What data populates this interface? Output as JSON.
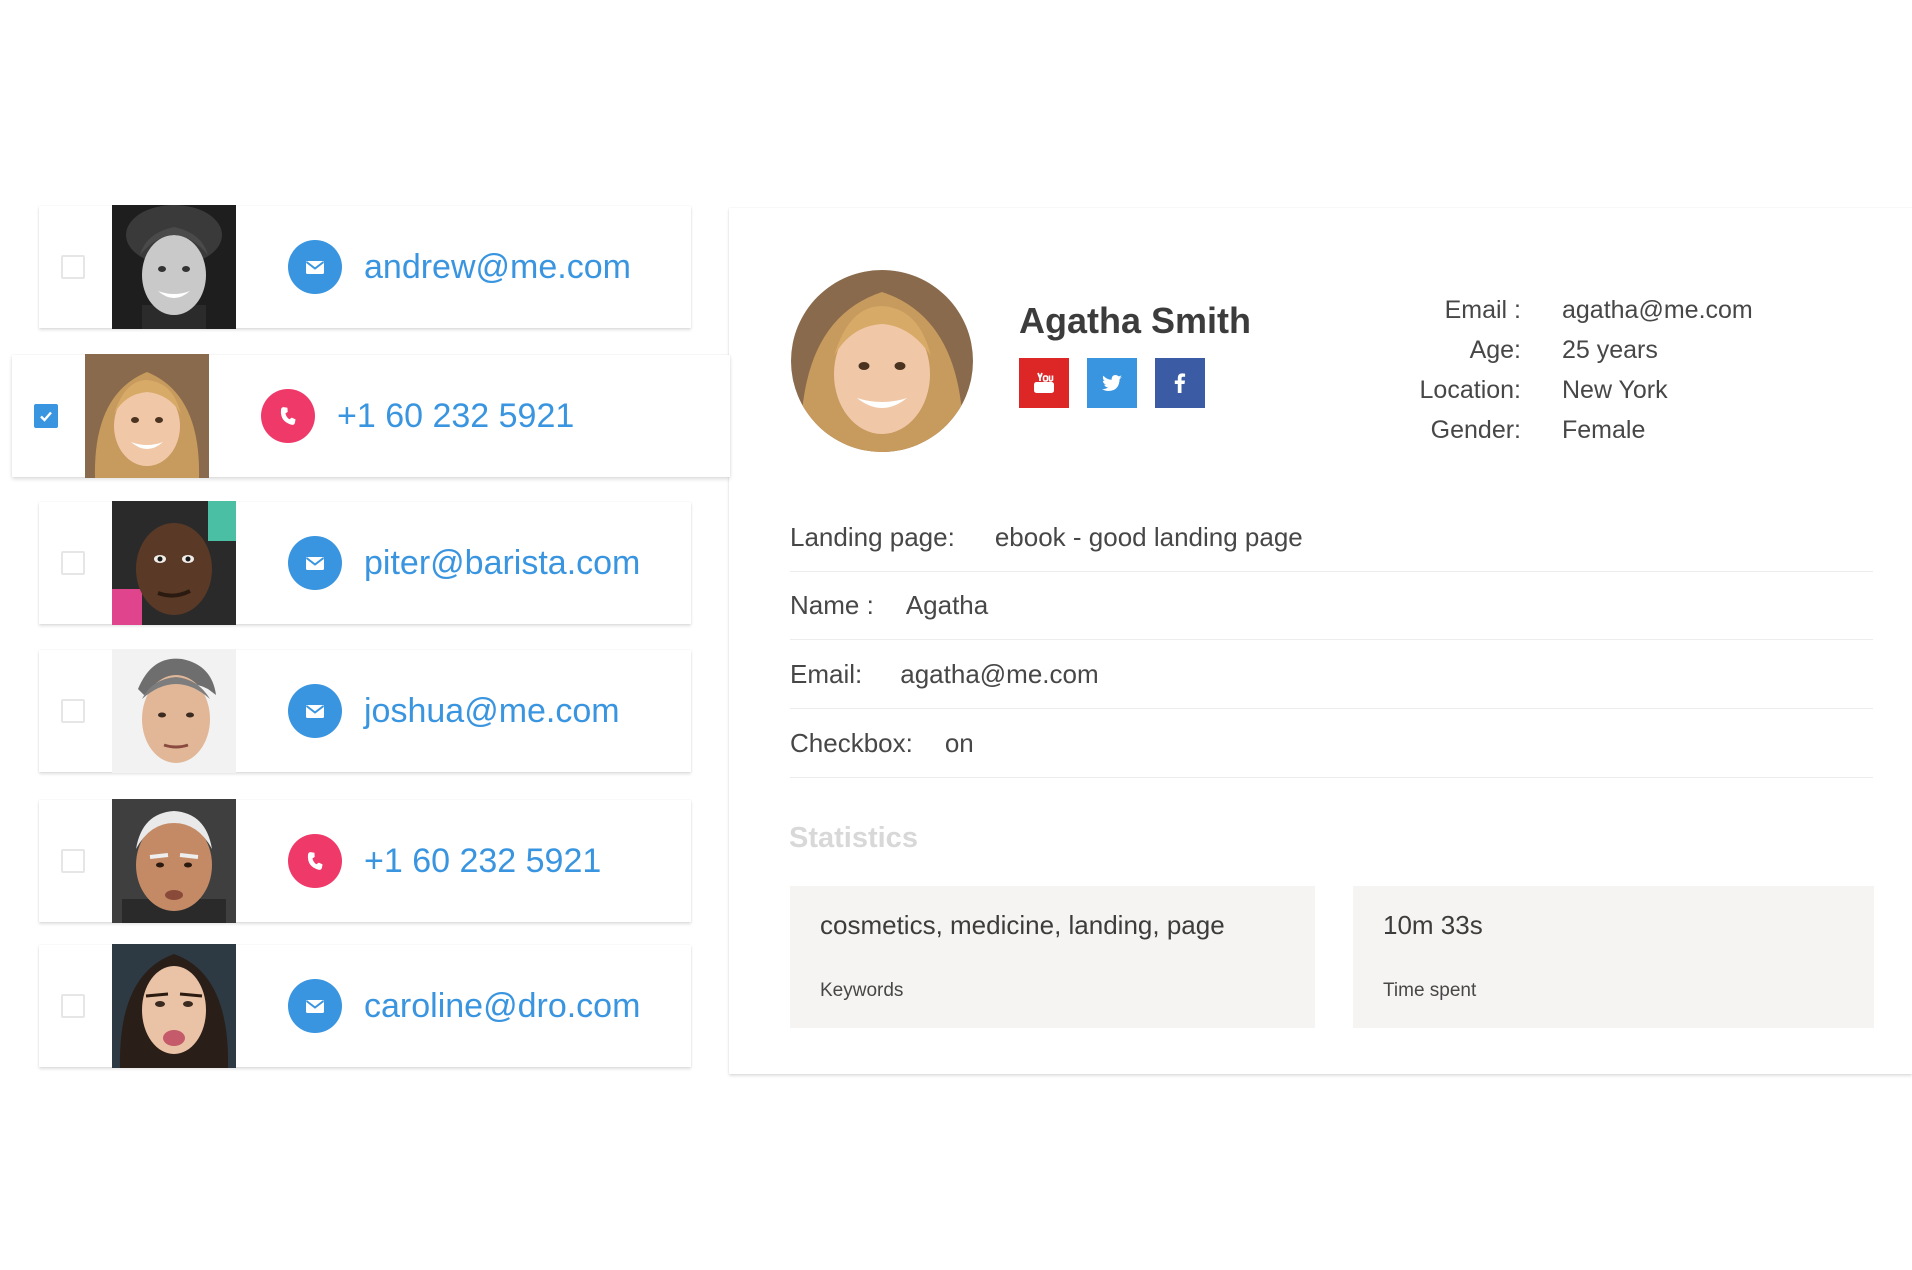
{
  "contacts": [
    {
      "value": "andrew@me.com",
      "type": "email",
      "checked": false
    },
    {
      "value": "+1  60 232 5921",
      "type": "phone",
      "checked": true
    },
    {
      "value": "piter@barista.com",
      "type": "email",
      "checked": false
    },
    {
      "value": "joshua@me.com",
      "type": "email",
      "checked": false
    },
    {
      "value": "+1  60 232 5921",
      "type": "phone",
      "checked": false
    },
    {
      "value": "caroline@dro.com",
      "type": "email",
      "checked": false
    }
  ],
  "profile": {
    "name": "Agatha Smith",
    "social": [
      "youtube-icon",
      "twitter-icon",
      "facebook-icon"
    ],
    "info": [
      {
        "label": "Email :",
        "value": "agatha@me.com"
      },
      {
        "label": "Age:",
        "value": "25 years"
      },
      {
        "label": "Location:",
        "value": "New York"
      },
      {
        "label": "Gender:",
        "value": "Female"
      }
    ]
  },
  "fields": [
    {
      "label": "Landing page:",
      "value": "ebook - good landing page"
    },
    {
      "label": "Name :",
      "value": "Agatha"
    },
    {
      "label": "Email:",
      "value": "agatha@me.com"
    },
    {
      "label": "Checkbox:",
      "value": "on"
    }
  ],
  "statistics": {
    "title": "Statistics",
    "keywords": {
      "value": "cosmetics, medicine, landing, page",
      "label": "Keywords"
    },
    "time": {
      "value": "10m 33s",
      "label": "Time spent"
    }
  },
  "colors": {
    "accent_blue": "#3a95e0",
    "phone_red": "#ef3a69",
    "youtube_red": "#dd2626",
    "facebook_blue": "#3b5ba5",
    "stat_card_bg": "#f5f4f2"
  }
}
